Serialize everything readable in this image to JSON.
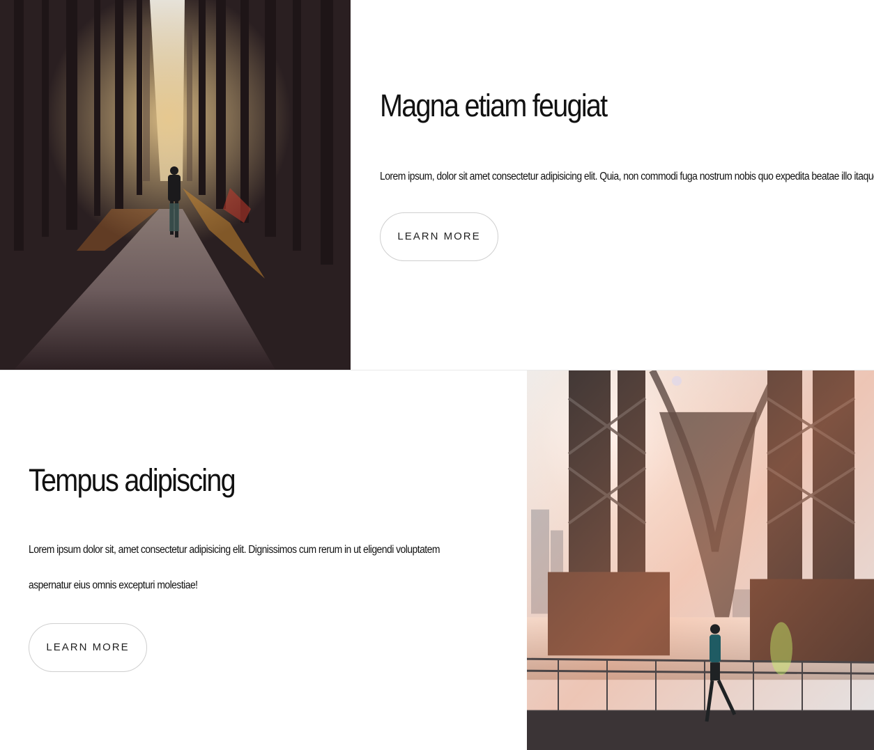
{
  "features": [
    {
      "title": "Magna etiam feugiat",
      "body": "Lorem ipsum, dolor sit amet consectetur adipisicing elit. Quia, non commodi fuga nostrum nobis quo expedita beatae illo itaque ipsum.",
      "button_label": "LEARN MORE",
      "image": "forest-runner-photo"
    },
    {
      "title": "Tempus adipiscing",
      "body": "Lorem ipsum dolor sit, amet consectetur adipisicing elit. Dignissimos cum rerum in ut eligendi voluptatem aspernatur eius omnis excepturi molestiae!",
      "button_label": "LEARN MORE",
      "image": "bridge-runner-photo"
    }
  ],
  "colors": {
    "background": "#ffffff",
    "text": "#111111",
    "button_border": "#cfcfcf"
  }
}
